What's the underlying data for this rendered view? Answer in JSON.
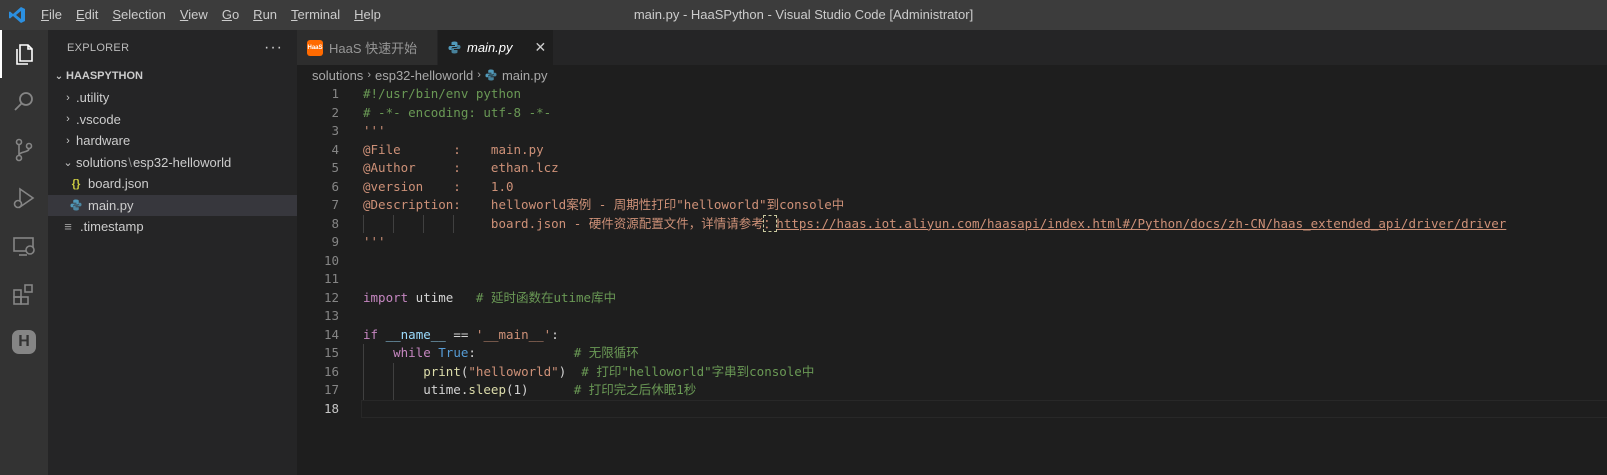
{
  "titlebar": {
    "menu": [
      {
        "mnemonic": "F",
        "rest": "ile"
      },
      {
        "mnemonic": "E",
        "rest": "dit"
      },
      {
        "mnemonic": "S",
        "rest": "election"
      },
      {
        "mnemonic": "V",
        "rest": "iew"
      },
      {
        "mnemonic": "G",
        "rest": "o"
      },
      {
        "mnemonic": "R",
        "rest": "un"
      },
      {
        "mnemonic": "T",
        "rest": "erminal"
      },
      {
        "mnemonic": "H",
        "rest": "elp"
      }
    ],
    "title": "main.py - HaaSPython - Visual Studio Code [Administrator]"
  },
  "activitybar": {
    "icons": [
      "explorer-icon",
      "search-icon",
      "source-control-icon",
      "run-debug-icon",
      "remote-explorer-icon",
      "extensions-icon",
      "haas-icon"
    ],
    "haas_letter": "H"
  },
  "sidebar": {
    "header": "EXPLORER",
    "more": "···",
    "root": "HAASPYTHON",
    "items": [
      {
        "type": "folder",
        "label": ".utility"
      },
      {
        "type": "folder",
        "label": ".vscode"
      },
      {
        "type": "folder",
        "label": "hardware"
      },
      {
        "type": "folder-open",
        "label_a": "solutions",
        "label_sep": "\\",
        "label_b": "esp32-helloworld"
      },
      {
        "type": "json",
        "icon": "{}",
        "label": "board.json"
      },
      {
        "type": "py",
        "label": "main.py"
      },
      {
        "type": "file",
        "label": ".timestamp"
      }
    ]
  },
  "tabs": [
    {
      "label": "HaaS 快速开始",
      "badge": "HaaS",
      "active": false
    },
    {
      "label": "main.py",
      "active": true,
      "close": "✕"
    }
  ],
  "breadcrumb": [
    "solutions",
    "esp32-helloworld",
    "main.py"
  ],
  "editor": {
    "current_line": 18,
    "lines": [
      {
        "n": "1",
        "code": [
          {
            "c": "cm",
            "t": "#!/usr/bin/env python"
          }
        ]
      },
      {
        "n": "2",
        "code": [
          {
            "c": "cm",
            "t": "# -*- encoding: utf-8 -*-"
          }
        ]
      },
      {
        "n": "3",
        "code": [
          {
            "c": "str",
            "t": "'''"
          }
        ]
      },
      {
        "n": "4",
        "code": [
          {
            "c": "str",
            "t": "@File       :    main.py"
          }
        ]
      },
      {
        "n": "5",
        "code": [
          {
            "c": "str",
            "t": "@Author     :    ethan.lcz"
          }
        ]
      },
      {
        "n": "6",
        "code": [
          {
            "c": "str",
            "t": "@version    :    1.0"
          }
        ]
      },
      {
        "n": "7",
        "code": [
          {
            "c": "str",
            "t": "@Description:    helloworld案例 - 周期性打印\"helloworld\"到console中"
          }
        ]
      },
      {
        "n": "8",
        "code": [
          {
            "c": "str",
            "t": "                 board.json - 硬件资源配置文件，详情请参考"
          },
          {
            "c": "str hl",
            "t": "："
          },
          {
            "c": "str url",
            "t": "https://haas.iot.aliyun.com/haasapi/index.html#/Python/docs/zh-CN/haas_extended_api/driver/driver"
          }
        ]
      },
      {
        "n": "9",
        "code": [
          {
            "c": "str",
            "t": "'''"
          }
        ]
      },
      {
        "n": "10",
        "code": []
      },
      {
        "n": "11",
        "code": []
      },
      {
        "n": "12",
        "code": [
          {
            "c": "kw",
            "t": "import"
          },
          {
            "c": "",
            "t": " utime   "
          },
          {
            "c": "cm",
            "t": "# 延时函数在utime库中"
          }
        ]
      },
      {
        "n": "13",
        "code": []
      },
      {
        "n": "14",
        "code": [
          {
            "c": "kw",
            "t": "if"
          },
          {
            "c": "",
            "t": " "
          },
          {
            "c": "var",
            "t": "__name__"
          },
          {
            "c": "",
            "t": " == "
          },
          {
            "c": "str",
            "t": "'__main__'"
          },
          {
            "c": "",
            "t": ":"
          }
        ]
      },
      {
        "n": "15",
        "code": [
          {
            "c": "",
            "t": "    "
          },
          {
            "c": "kw",
            "t": "while"
          },
          {
            "c": "",
            "t": " "
          },
          {
            "c": "bl",
            "t": "True"
          },
          {
            "c": "",
            "t": ":             "
          },
          {
            "c": "cm",
            "t": "# 无限循环"
          }
        ]
      },
      {
        "n": "16",
        "code": [
          {
            "c": "",
            "t": "        "
          },
          {
            "c": "fn",
            "t": "print"
          },
          {
            "c": "",
            "t": "("
          },
          {
            "c": "str",
            "t": "\"helloworld\""
          },
          {
            "c": "",
            "t": ")  "
          },
          {
            "c": "cm",
            "t": "# 打印\"helloworld\"字串到console中"
          }
        ]
      },
      {
        "n": "17",
        "code": [
          {
            "c": "",
            "t": "        utime."
          },
          {
            "c": "fn",
            "t": "sleep"
          },
          {
            "c": "",
            "t": "(1)      "
          },
          {
            "c": "cm",
            "t": "# 打印完之后休眠1秒"
          }
        ]
      },
      {
        "n": "18",
        "code": []
      }
    ]
  }
}
